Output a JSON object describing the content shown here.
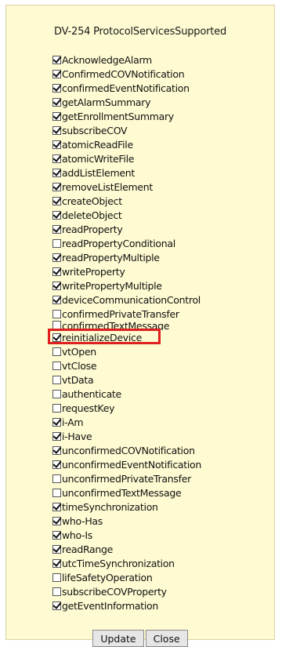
{
  "title": "DV-254 ProtocolServicesSupported",
  "services": [
    {
      "label": "AcknowledgeAlarm",
      "checked": true
    },
    {
      "label": "ConfirmedCOVNotification",
      "checked": true
    },
    {
      "label": "confirmedEventNotification",
      "checked": true
    },
    {
      "label": "getAlarmSummary",
      "checked": true
    },
    {
      "label": "getEnrollmentSummary",
      "checked": true
    },
    {
      "label": "subscribeCOV",
      "checked": true
    },
    {
      "label": "atomicReadFile",
      "checked": true
    },
    {
      "label": "atomicWriteFile",
      "checked": true
    },
    {
      "label": "addListElement",
      "checked": true
    },
    {
      "label": "removeListElement",
      "checked": true
    },
    {
      "label": "createObject",
      "checked": true
    },
    {
      "label": "deleteObject",
      "checked": true
    },
    {
      "label": "readProperty",
      "checked": true
    },
    {
      "label": "readPropertyConditional",
      "checked": false
    },
    {
      "label": "readPropertyMultiple",
      "checked": true
    },
    {
      "label": "writeProperty",
      "checked": true
    },
    {
      "label": "writePropertyMultiple",
      "checked": true
    },
    {
      "label": "deviceCommunicationControl",
      "checked": true
    },
    {
      "label": "confirmedPrivateTransfer",
      "checked": false
    },
    {
      "label": "confirmedTextMessage",
      "checked": false,
      "partially_hidden": true
    },
    {
      "label": "reinitializeDevice",
      "checked": true,
      "highlighted": true
    },
    {
      "label": "vtOpen",
      "checked": false
    },
    {
      "label": "vtClose",
      "checked": false
    },
    {
      "label": "vtData",
      "checked": false
    },
    {
      "label": "authenticate",
      "checked": false
    },
    {
      "label": "requestKey",
      "checked": false
    },
    {
      "label": "i-Am",
      "checked": true
    },
    {
      "label": "i-Have",
      "checked": true
    },
    {
      "label": "unconfirmedCOVNotification",
      "checked": true
    },
    {
      "label": "unconfirmedEventNotification",
      "checked": true
    },
    {
      "label": "unconfirmedPrivateTransfer",
      "checked": false
    },
    {
      "label": "unconfirmedTextMessage",
      "checked": false
    },
    {
      "label": "timeSynchronization",
      "checked": true
    },
    {
      "label": "who-Has",
      "checked": true
    },
    {
      "label": "who-Is",
      "checked": true
    },
    {
      "label": "readRange",
      "checked": true
    },
    {
      "label": "utcTimeSynchronization",
      "checked": true
    },
    {
      "label": "lifeSafetyOperation",
      "checked": false
    },
    {
      "label": "subscribeCOVProperty",
      "checked": false
    },
    {
      "label": "getEventInformation",
      "checked": true
    }
  ],
  "buttons": {
    "update_label": "Update",
    "close_label": "Close"
  },
  "colors": {
    "panel_background": "#fefbd2",
    "highlight_border": "#e01f1f"
  }
}
